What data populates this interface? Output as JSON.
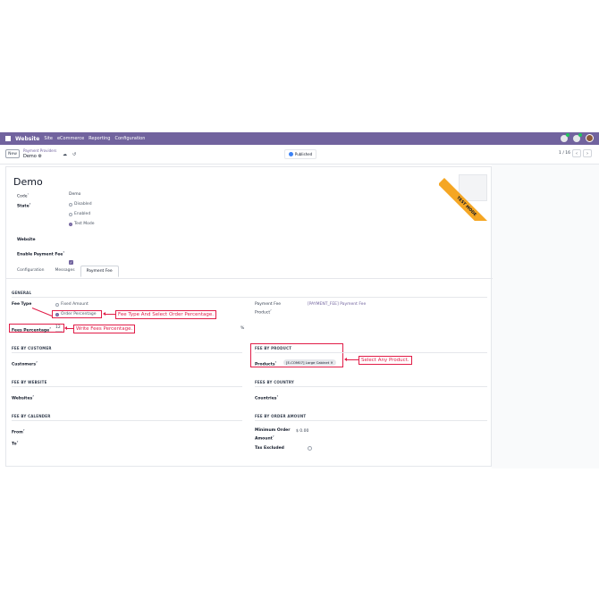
{
  "topbar": {
    "brand": "Website",
    "menu": [
      "Site",
      "eCommerce",
      "Reporting",
      "Configuration"
    ]
  },
  "control": {
    "new_label": "New",
    "breadcrumb_parent": "Payment Providers",
    "breadcrumb_current": "Demo",
    "published_label": "Published",
    "pager": "1 / 16"
  },
  "form": {
    "title": "Demo",
    "ribbon": "TEST MODE",
    "code_label": "Code",
    "code_value": "Demo",
    "state_label": "State",
    "state_options": [
      "Disabled",
      "Enabled",
      "Test Mode"
    ],
    "website_label": "Website",
    "enable_fee_label": "Enable Payment Fee",
    "tabs": [
      "Configuration",
      "Messages",
      "Payment Fee"
    ],
    "sections": {
      "general": "GENERAL",
      "by_customer": "FEE BY CUSTOMER",
      "by_product": "FEE BY PRODUCT",
      "by_website": "FEE BY WEBSITE",
      "by_country": "FEES BY COUNTRY",
      "by_calender": "FEE BY CALENDER",
      "by_order_amount": "FEE BY ORDER AMOUNT"
    },
    "fee_type_label": "Fee Type",
    "fee_type_options": [
      "Fixed Amount",
      "Order Percentage"
    ],
    "fees_percentage_label": "Fees Percentage",
    "fees_percentage_value": "12",
    "percent_sign": "%",
    "payment_fee_product_label_1": "Payment Fee",
    "payment_fee_product_label_2": "Product",
    "payment_fee_product_value": "[PAYMENT_FEE] Payment Fee",
    "customers_label": "Customers",
    "products_label": "Products",
    "product_tag": "[E-COM07] Large Cabinet",
    "websites_label": "Websites",
    "countries_label": "Countries",
    "from_label": "From",
    "to_label": "To",
    "min_order_label_1": "Minimum Order",
    "min_order_label_2": "Amount",
    "min_order_value": "$ 0.00",
    "tax_excluded_label": "Tax Excluded"
  },
  "annotations": {
    "fee_type": "Fee Type And Select Order Percentage.",
    "fees_percentage": "Write Fees Percentage.",
    "product": "Select Any Product."
  }
}
